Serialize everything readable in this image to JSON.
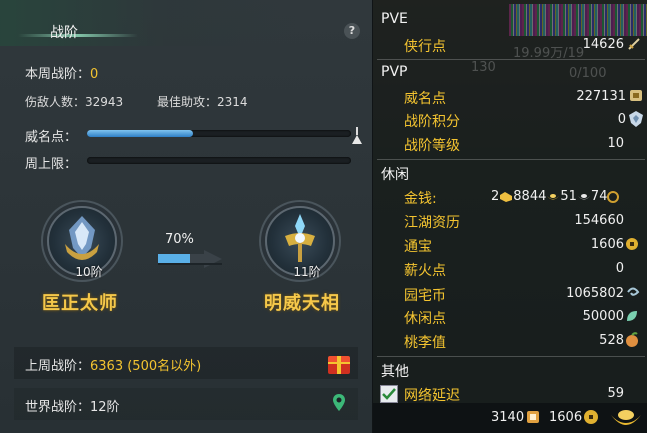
{
  "left_panel": {
    "title": "战阶",
    "help_label": "?",
    "weekly_rank_label": "本周战阶：",
    "weekly_rank_value": "0",
    "injured_count_label": "伤敌人数：",
    "injured_count_value": "32943",
    "best_assist_label": "最佳助攻：",
    "best_assist_value": "2314",
    "reputation_label": "威名点：",
    "reputation_progress": 0.4,
    "weekly_limit_label": "周上限：",
    "weekly_limit_progress": 0.0,
    "current_rank_level": "10阶",
    "current_rank_name": "匡正太师",
    "progress_percent": "70%",
    "next_rank_level": "11阶",
    "next_rank_name": "明威天相",
    "last_week_label": "上周战阶：",
    "last_week_value": "6363 (500名以外)",
    "world_rank_label": "世界战阶：",
    "world_rank_value": "12阶"
  },
  "right_panel": {
    "pve_header": "PVE",
    "pve_items": [
      {
        "label": "侠行点",
        "value": "14626",
        "icon": "sword-icon"
      }
    ],
    "pvp_header": "PVP",
    "pvp_items": [
      {
        "label": "威名点",
        "value": "227131",
        "icon": "banner-icon"
      },
      {
        "label": "战阶积分",
        "value": "0",
        "icon": "shield-crest-icon"
      },
      {
        "label": "战阶等级",
        "value": "10",
        "icon": ""
      }
    ],
    "leisure_header": "休闲",
    "money_label": "金钱:",
    "money_gold": "2",
    "money_silver": "8844",
    "money_copper1": "51",
    "money_copper2": "74",
    "leisure_items": [
      {
        "label": "江湖资历",
        "value": "154660",
        "icon": ""
      },
      {
        "label": "通宝",
        "value": "1606",
        "icon": "coin-icon"
      },
      {
        "label": "薪火点",
        "value": "0",
        "icon": ""
      },
      {
        "label": "园宅币",
        "value": "1065802",
        "icon": "swirl-coin-icon"
      },
      {
        "label": "休闲点",
        "value": "50000",
        "icon": "leaf-icon"
      },
      {
        "label": "桃李值",
        "value": "528",
        "icon": "peach-icon"
      }
    ],
    "other_header": "其他",
    "network_label": "网络延迟",
    "network_value": "59",
    "network_checked": true,
    "bottom_value_1": "3140",
    "bottom_value_2": "1606",
    "bg_ghost_1": "19.99万/19",
    "bg_ghost_2": "130",
    "bg_ghost_3": "0/100",
    "colors": {
      "gold": "#f4c430",
      "progress_blue": "#2e7fc6"
    }
  }
}
